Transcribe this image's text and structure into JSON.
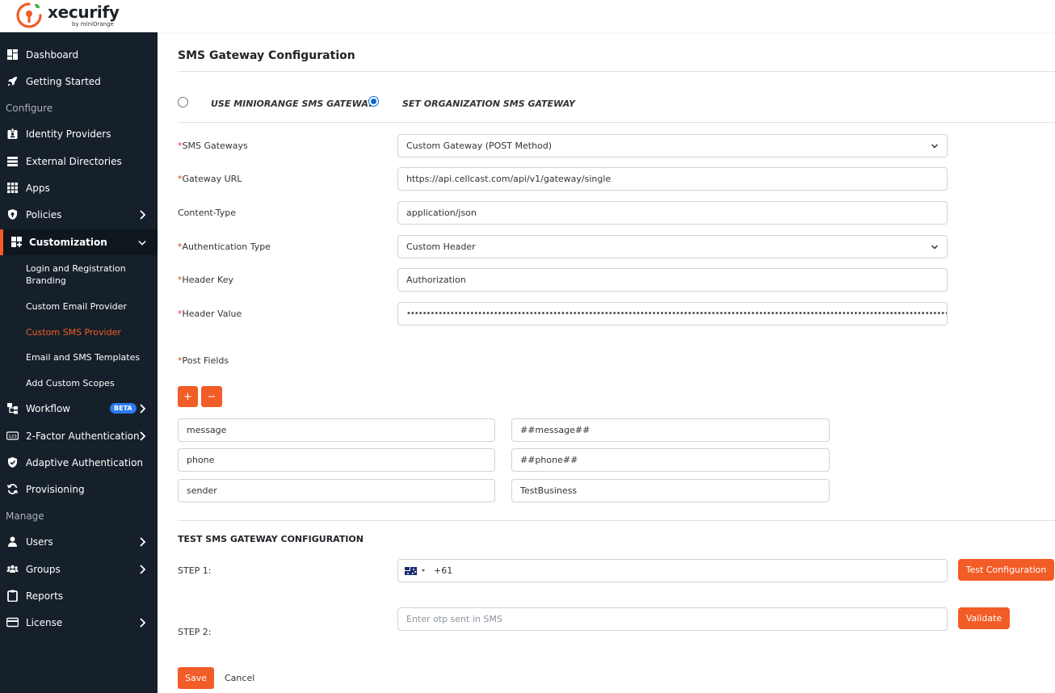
{
  "brand": {
    "name": "xecurify",
    "by": "by miniOrange",
    "accent": "#f25c26"
  },
  "sidebar": {
    "items_top": [
      {
        "label": "Dashboard",
        "icon": "dashboard-icon"
      },
      {
        "label": "Getting Started",
        "icon": "rocket-icon"
      }
    ],
    "section_configure": "Configure",
    "configure_items": [
      {
        "label": "Identity Providers",
        "icon": "id-card-icon"
      },
      {
        "label": "External Directories",
        "icon": "list-icon"
      },
      {
        "label": "Apps",
        "icon": "grid-icon"
      },
      {
        "label": "Policies",
        "icon": "shield-lock-icon"
      },
      {
        "label": "Customization",
        "icon": "customization-icon"
      }
    ],
    "customization_sub": [
      {
        "label": "Login and Registration"
      },
      {
        "label": "Branding"
      },
      {
        "label": "Custom Email Provider"
      },
      {
        "label": "Custom SMS Provider"
      },
      {
        "label": "Email and SMS Templates"
      },
      {
        "label": "Add Custom Scopes"
      }
    ],
    "more_items": [
      {
        "label": "Workflow",
        "icon": "workflow-icon",
        "badge": "BETA"
      },
      {
        "label": "2-Factor Authentication",
        "icon": "123-icon"
      },
      {
        "label": "Adaptive Authentication",
        "icon": "shield-check-icon"
      },
      {
        "label": "Provisioning",
        "icon": "sync-icon"
      }
    ],
    "section_manage": "Manage",
    "manage_items": [
      {
        "label": "Users",
        "icon": "user-icon"
      },
      {
        "label": "Groups",
        "icon": "users-icon"
      },
      {
        "label": "Reports",
        "icon": "clipboard-icon"
      },
      {
        "label": "License",
        "icon": "card-icon"
      }
    ]
  },
  "main": {
    "title": "SMS Gateway Configuration",
    "radio_options": [
      {
        "label": "USE MINIORANGE SMS GATEWAY",
        "checked": false
      },
      {
        "label": "SET ORGANIZATION SMS GATEWAY",
        "checked": true
      }
    ],
    "fields": {
      "sms_gateways": {
        "label": "SMS Gateways",
        "value": "Custom Gateway (POST Method)"
      },
      "gateway_url": {
        "label": "Gateway URL",
        "value": "https://api.cellcast.com/api/v1/gateway/single"
      },
      "content_type": {
        "label": "Content-Type",
        "value": "application/json"
      },
      "auth_type": {
        "label": "Authentication Type",
        "value": "Custom Header"
      },
      "header_key": {
        "label": "Header Key",
        "value": "Authorization"
      },
      "header_value": {
        "label": "Header Value",
        "value": "••••••••••••••••••••••••••••••••••••••••••••••••••••••••••••••••••••••••••••••••••••••••••••••••••••••••••••••••••••••••••••••••••••••••••••••••••••••••••••••••••••••••••••••••••••••••••••••••••••••••"
      }
    },
    "post_fields_label": "Post Fields",
    "add_label": "+",
    "remove_label": "−",
    "post_fields": [
      {
        "key": "message",
        "value": "##message##"
      },
      {
        "key": "phone",
        "value": "##phone##"
      },
      {
        "key": "sender",
        "value": "TestBusiness"
      }
    ],
    "test_section": {
      "title": "TEST SMS GATEWAY CONFIGURATION",
      "step1_label": "STEP 1:",
      "phone_code": "+61",
      "test_button": "Test Configuration",
      "step2_label": "STEP 2:",
      "otp_placeholder": "Enter otp sent in SMS",
      "validate_button": "Validate"
    },
    "save_label": "Save",
    "cancel_label": "Cancel"
  }
}
